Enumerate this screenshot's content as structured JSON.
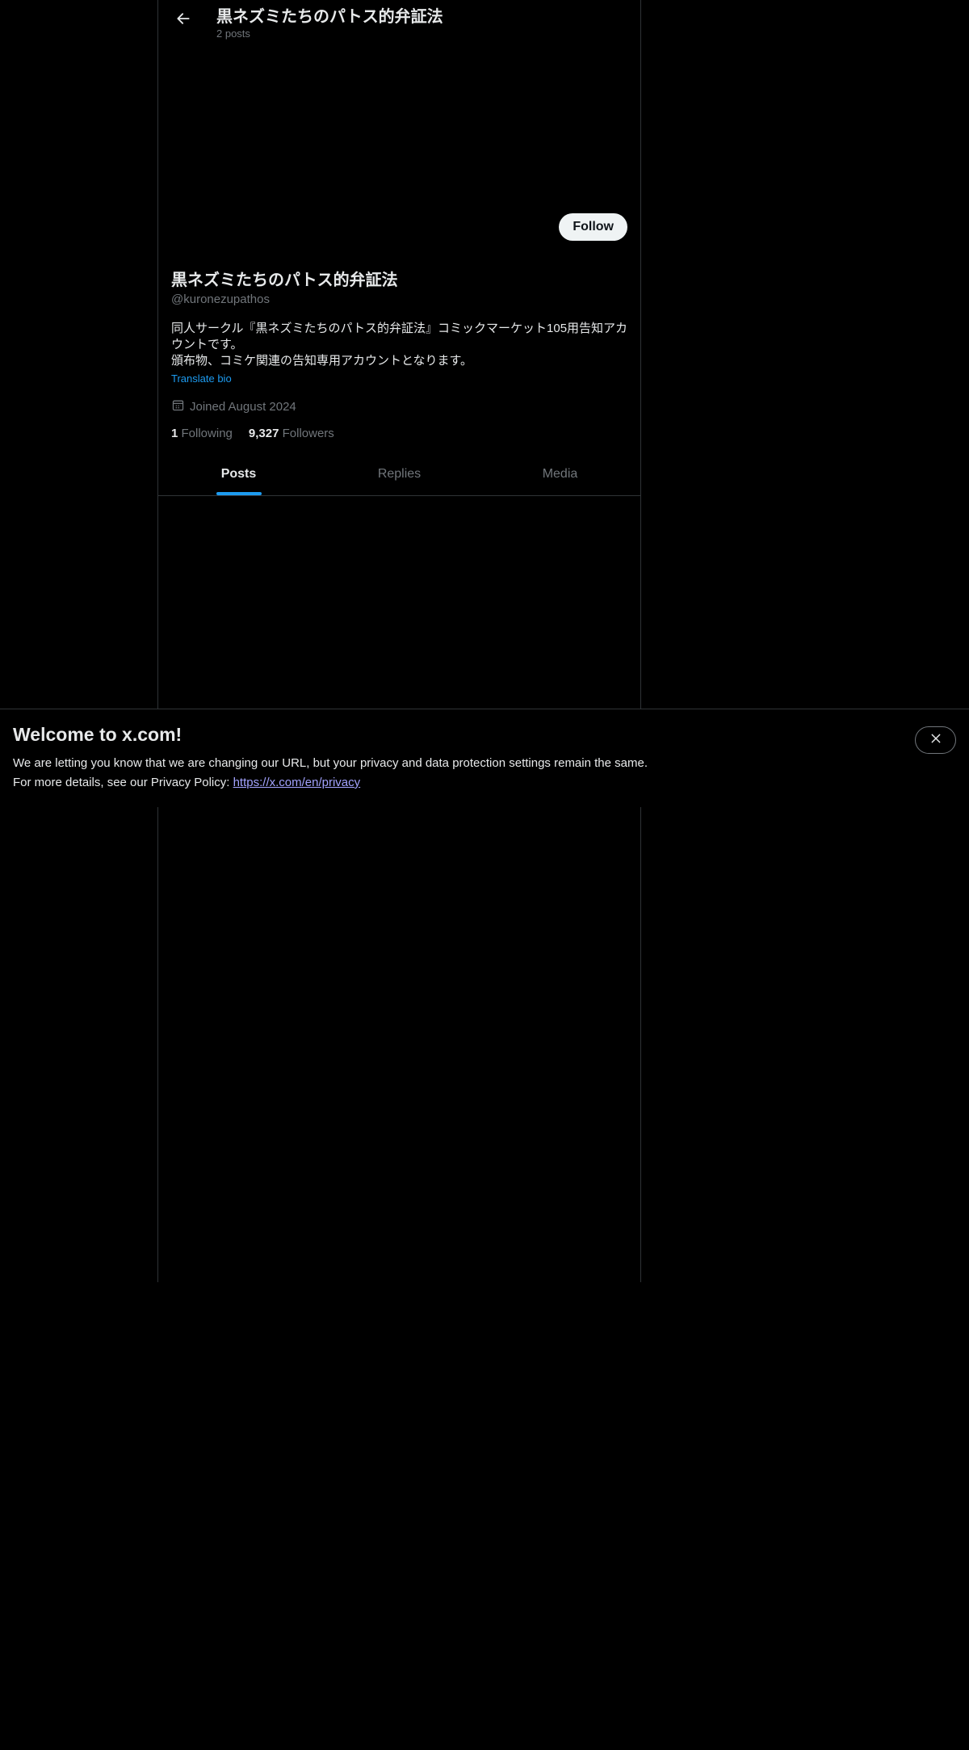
{
  "header": {
    "title": "黒ネズミたちのパトス的弁証法",
    "posts_count": "2 posts",
    "back_icon": "arrow-left-icon"
  },
  "profile": {
    "follow_label": "Follow",
    "display_name": "黒ネズミたちのパトス的弁証法",
    "handle": "@kuronezupathos",
    "bio_lines": [
      "同人サークル『黒ネズミたちのパトス的弁証法』コミックマーケット105用告知アカウントです。",
      "頒布物、コミケ関連の告知専用アカウントとなります。"
    ],
    "translate_bio": "Translate bio",
    "joined": "Joined August 2024",
    "following_count": "1",
    "following_label": "Following",
    "followers_count": "9,327",
    "followers_label": "Followers"
  },
  "tabs": [
    {
      "label": "Posts",
      "active": true
    },
    {
      "label": "Replies",
      "active": false
    },
    {
      "label": "Media",
      "active": false
    }
  ],
  "notice": {
    "title": "Welcome to x.com!",
    "line1": "We are letting you know that we are changing our URL, but your privacy and data protection settings remain the same.",
    "line2_prefix": "For more details, see our Privacy Policy: ",
    "link": "https://x.com/en/privacy",
    "close_icon": "close-icon"
  },
  "colors": {
    "background": "#000000",
    "text_primary": "#e7e9ea",
    "text_secondary": "#71767b",
    "accent": "#1d9bf0",
    "border": "#2f3336",
    "link": "#a3a3ff"
  }
}
